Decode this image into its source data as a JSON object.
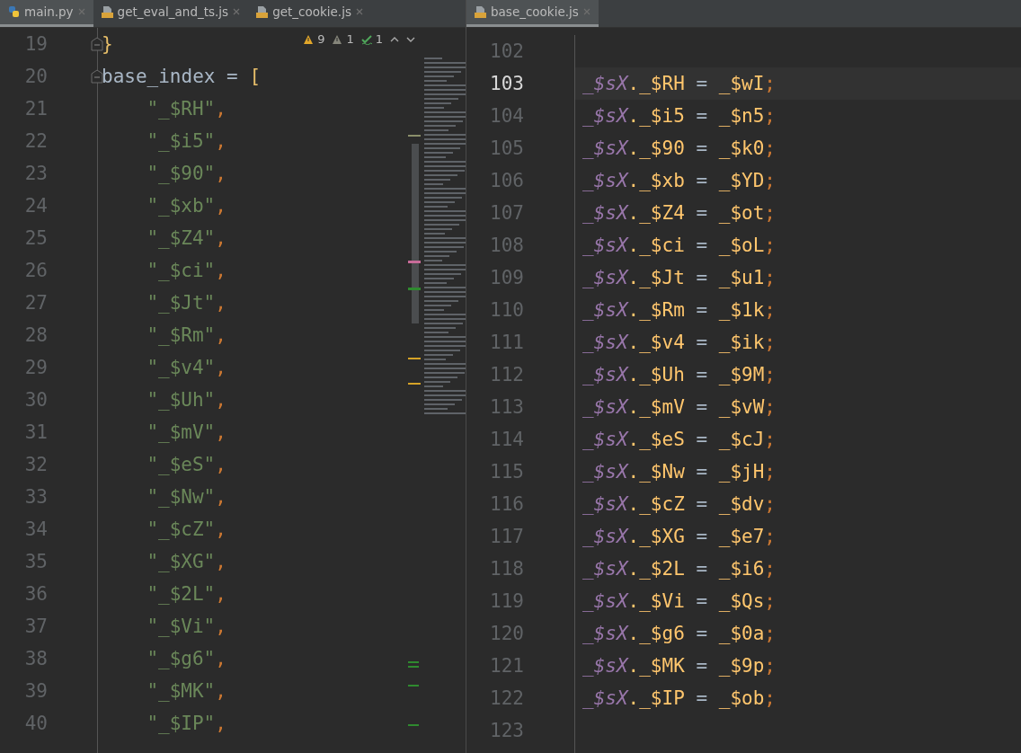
{
  "left_pane": {
    "tabs": [
      {
        "label": "main.py",
        "kind": "python",
        "selected": true
      },
      {
        "label": "get_eval_and_ts.js",
        "kind": "js",
        "selected": false
      },
      {
        "label": "get_cookie.js",
        "kind": "js",
        "selected": false
      }
    ],
    "inspections": [
      {
        "kind": "warning",
        "count": "9"
      },
      {
        "kind": "weak",
        "count": "1"
      },
      {
        "kind": "typo",
        "count": "1"
      }
    ],
    "lines": [
      {
        "number": "19",
        "fold": true,
        "tokens": [
          {
            "kind": "brace",
            "text": "}"
          }
        ]
      },
      {
        "number": "20",
        "fold": true,
        "tokens": [
          {
            "kind": "plain",
            "text": "base_index = "
          },
          {
            "kind": "brace",
            "text": "["
          }
        ]
      },
      {
        "number": "21",
        "indented": true,
        "tokens": [
          {
            "kind": "string",
            "text": "\"_$RH\""
          },
          {
            "kind": "punct",
            "text": ","
          }
        ]
      },
      {
        "number": "22",
        "indented": true,
        "tokens": [
          {
            "kind": "string",
            "text": "\"_$i5\""
          },
          {
            "kind": "punct",
            "text": ","
          }
        ]
      },
      {
        "number": "23",
        "indented": true,
        "tokens": [
          {
            "kind": "string",
            "text": "\"_$90\""
          },
          {
            "kind": "punct",
            "text": ","
          }
        ]
      },
      {
        "number": "24",
        "indented": true,
        "tokens": [
          {
            "kind": "string",
            "text": "\"_$xb\""
          },
          {
            "kind": "punct",
            "text": ","
          }
        ]
      },
      {
        "number": "25",
        "indented": true,
        "tokens": [
          {
            "kind": "string",
            "text": "\"_$Z4\""
          },
          {
            "kind": "punct",
            "text": ","
          }
        ]
      },
      {
        "number": "26",
        "indented": true,
        "tokens": [
          {
            "kind": "string",
            "text": "\"_$ci\""
          },
          {
            "kind": "punct",
            "text": ","
          }
        ]
      },
      {
        "number": "27",
        "indented": true,
        "tokens": [
          {
            "kind": "string",
            "text": "\"_$Jt\""
          },
          {
            "kind": "punct",
            "text": ","
          }
        ]
      },
      {
        "number": "28",
        "indented": true,
        "tokens": [
          {
            "kind": "string",
            "text": "\"_$Rm\""
          },
          {
            "kind": "punct",
            "text": ","
          }
        ]
      },
      {
        "number": "29",
        "indented": true,
        "tokens": [
          {
            "kind": "string",
            "text": "\"_$v4\""
          },
          {
            "kind": "punct",
            "text": ","
          }
        ]
      },
      {
        "number": "30",
        "indented": true,
        "tokens": [
          {
            "kind": "string",
            "text": "\"_$Uh\""
          },
          {
            "kind": "punct",
            "text": ","
          }
        ]
      },
      {
        "number": "31",
        "indented": true,
        "tokens": [
          {
            "kind": "string",
            "text": "\"_$mV\""
          },
          {
            "kind": "punct",
            "text": ","
          }
        ]
      },
      {
        "number": "32",
        "indented": true,
        "tokens": [
          {
            "kind": "string",
            "text": "\"_$eS\""
          },
          {
            "kind": "punct",
            "text": ","
          }
        ]
      },
      {
        "number": "33",
        "indented": true,
        "tokens": [
          {
            "kind": "string",
            "text": "\"_$Nw\""
          },
          {
            "kind": "punct",
            "text": ","
          }
        ]
      },
      {
        "number": "34",
        "indented": true,
        "tokens": [
          {
            "kind": "string",
            "text": "\"_$cZ\""
          },
          {
            "kind": "punct",
            "text": ","
          }
        ]
      },
      {
        "number": "35",
        "indented": true,
        "tokens": [
          {
            "kind": "string",
            "text": "\"_$XG\""
          },
          {
            "kind": "punct",
            "text": ","
          }
        ]
      },
      {
        "number": "36",
        "indented": true,
        "tokens": [
          {
            "kind": "string",
            "text": "\"_$2L\""
          },
          {
            "kind": "punct",
            "text": ","
          }
        ]
      },
      {
        "number": "37",
        "indented": true,
        "tokens": [
          {
            "kind": "string",
            "text": "\"_$Vi\""
          },
          {
            "kind": "punct",
            "text": ","
          }
        ]
      },
      {
        "number": "38",
        "indented": true,
        "tokens": [
          {
            "kind": "string",
            "text": "\"_$g6\""
          },
          {
            "kind": "punct",
            "text": ","
          }
        ]
      },
      {
        "number": "39",
        "indented": true,
        "tokens": [
          {
            "kind": "string",
            "text": "\"_$MK\""
          },
          {
            "kind": "punct",
            "text": ","
          }
        ]
      },
      {
        "number": "40",
        "indented": true,
        "tokens": [
          {
            "kind": "string",
            "text": "\"_$IP\""
          },
          {
            "kind": "punct",
            "text": ","
          }
        ]
      }
    ]
  },
  "right_pane": {
    "tabs": [
      {
        "label": "base_cookie.js",
        "kind": "js",
        "selected": true
      }
    ],
    "lines": [
      {
        "number": "102",
        "current": false
      },
      {
        "number": "103",
        "current": true,
        "tokens": [
          {
            "kind": "object",
            "text": "_$sX"
          },
          {
            "kind": "prop",
            "text": "._$RH"
          },
          {
            "kind": "plain",
            "text": " = "
          },
          {
            "kind": "prop",
            "text": "_$wI"
          },
          {
            "kind": "punct",
            "text": ";"
          }
        ]
      },
      {
        "number": "104",
        "current": false,
        "tokens": [
          {
            "kind": "object",
            "text": "_$sX"
          },
          {
            "kind": "prop",
            "text": "._$i5"
          },
          {
            "kind": "plain",
            "text": " = "
          },
          {
            "kind": "prop",
            "text": "_$n5"
          },
          {
            "kind": "punct",
            "text": ";"
          }
        ]
      },
      {
        "number": "105",
        "current": false,
        "tokens": [
          {
            "kind": "object",
            "text": "_$sX"
          },
          {
            "kind": "prop",
            "text": "._$90"
          },
          {
            "kind": "plain",
            "text": " = "
          },
          {
            "kind": "prop",
            "text": "_$k0"
          },
          {
            "kind": "punct",
            "text": ";"
          }
        ]
      },
      {
        "number": "106",
        "current": false,
        "tokens": [
          {
            "kind": "object",
            "text": "_$sX"
          },
          {
            "kind": "prop",
            "text": "._$xb"
          },
          {
            "kind": "plain",
            "text": " = "
          },
          {
            "kind": "prop",
            "text": "_$YD"
          },
          {
            "kind": "punct",
            "text": ";"
          }
        ]
      },
      {
        "number": "107",
        "current": false,
        "tokens": [
          {
            "kind": "object",
            "text": "_$sX"
          },
          {
            "kind": "prop",
            "text": "._$Z4"
          },
          {
            "kind": "plain",
            "text": " = "
          },
          {
            "kind": "prop",
            "text": "_$ot"
          },
          {
            "kind": "punct",
            "text": ";"
          }
        ]
      },
      {
        "number": "108",
        "current": false,
        "tokens": [
          {
            "kind": "object",
            "text": "_$sX"
          },
          {
            "kind": "prop",
            "text": "._$ci"
          },
          {
            "kind": "plain",
            "text": " = "
          },
          {
            "kind": "prop",
            "text": "_$oL"
          },
          {
            "kind": "punct",
            "text": ";"
          }
        ]
      },
      {
        "number": "109",
        "current": false,
        "tokens": [
          {
            "kind": "object",
            "text": "_$sX"
          },
          {
            "kind": "prop",
            "text": "._$Jt"
          },
          {
            "kind": "plain",
            "text": " = "
          },
          {
            "kind": "prop",
            "text": "_$u1"
          },
          {
            "kind": "punct",
            "text": ";"
          }
        ]
      },
      {
        "number": "110",
        "current": false,
        "tokens": [
          {
            "kind": "object",
            "text": "_$sX"
          },
          {
            "kind": "prop",
            "text": "._$Rm"
          },
          {
            "kind": "plain",
            "text": " = "
          },
          {
            "kind": "prop",
            "text": "_$1k"
          },
          {
            "kind": "punct",
            "text": ";"
          }
        ]
      },
      {
        "number": "111",
        "current": false,
        "tokens": [
          {
            "kind": "object",
            "text": "_$sX"
          },
          {
            "kind": "prop",
            "text": "._$v4"
          },
          {
            "kind": "plain",
            "text": " = "
          },
          {
            "kind": "prop",
            "text": "_$ik"
          },
          {
            "kind": "punct",
            "text": ";"
          }
        ]
      },
      {
        "number": "112",
        "current": false,
        "tokens": [
          {
            "kind": "object",
            "text": "_$sX"
          },
          {
            "kind": "prop",
            "text": "._$Uh"
          },
          {
            "kind": "plain",
            "text": " = "
          },
          {
            "kind": "prop",
            "text": "_$9M"
          },
          {
            "kind": "punct",
            "text": ";"
          }
        ]
      },
      {
        "number": "113",
        "current": false,
        "tokens": [
          {
            "kind": "object",
            "text": "_$sX"
          },
          {
            "kind": "prop",
            "text": "._$mV"
          },
          {
            "kind": "plain",
            "text": " = "
          },
          {
            "kind": "prop",
            "text": "_$vW"
          },
          {
            "kind": "punct",
            "text": ";"
          }
        ]
      },
      {
        "number": "114",
        "current": false,
        "tokens": [
          {
            "kind": "object",
            "text": "_$sX"
          },
          {
            "kind": "prop",
            "text": "._$eS"
          },
          {
            "kind": "plain",
            "text": " = "
          },
          {
            "kind": "prop",
            "text": "_$cJ"
          },
          {
            "kind": "punct",
            "text": ";"
          }
        ]
      },
      {
        "number": "115",
        "current": false,
        "tokens": [
          {
            "kind": "object",
            "text": "_$sX"
          },
          {
            "kind": "prop",
            "text": "._$Nw"
          },
          {
            "kind": "plain",
            "text": " = "
          },
          {
            "kind": "prop",
            "text": "_$jH"
          },
          {
            "kind": "punct",
            "text": ";"
          }
        ]
      },
      {
        "number": "116",
        "current": false,
        "tokens": [
          {
            "kind": "object",
            "text": "_$sX"
          },
          {
            "kind": "prop",
            "text": "._$cZ"
          },
          {
            "kind": "plain",
            "text": " = "
          },
          {
            "kind": "prop",
            "text": "_$dv"
          },
          {
            "kind": "punct",
            "text": ";"
          }
        ]
      },
      {
        "number": "117",
        "current": false,
        "tokens": [
          {
            "kind": "object",
            "text": "_$sX"
          },
          {
            "kind": "prop",
            "text": "._$XG"
          },
          {
            "kind": "plain",
            "text": " = "
          },
          {
            "kind": "prop",
            "text": "_$e7"
          },
          {
            "kind": "punct",
            "text": ";"
          }
        ]
      },
      {
        "number": "118",
        "current": false,
        "tokens": [
          {
            "kind": "object",
            "text": "_$sX"
          },
          {
            "kind": "prop",
            "text": "._$2L"
          },
          {
            "kind": "plain",
            "text": " = "
          },
          {
            "kind": "prop",
            "text": "_$i6"
          },
          {
            "kind": "punct",
            "text": ";"
          }
        ]
      },
      {
        "number": "119",
        "current": false,
        "tokens": [
          {
            "kind": "object",
            "text": "_$sX"
          },
          {
            "kind": "prop",
            "text": "._$Vi"
          },
          {
            "kind": "plain",
            "text": " = "
          },
          {
            "kind": "prop",
            "text": "_$Qs"
          },
          {
            "kind": "punct",
            "text": ";"
          }
        ]
      },
      {
        "number": "120",
        "current": false,
        "tokens": [
          {
            "kind": "object",
            "text": "_$sX"
          },
          {
            "kind": "prop",
            "text": "._$g6"
          },
          {
            "kind": "plain",
            "text": " = "
          },
          {
            "kind": "prop",
            "text": "_$0a"
          },
          {
            "kind": "punct",
            "text": ";"
          }
        ]
      },
      {
        "number": "121",
        "current": false,
        "tokens": [
          {
            "kind": "object",
            "text": "_$sX"
          },
          {
            "kind": "prop",
            "text": "._$MK"
          },
          {
            "kind": "plain",
            "text": " = "
          },
          {
            "kind": "prop",
            "text": "_$9p"
          },
          {
            "kind": "punct",
            "text": ";"
          }
        ]
      },
      {
        "number": "122",
        "current": false,
        "tokens": [
          {
            "kind": "object",
            "text": "_$sX"
          },
          {
            "kind": "prop",
            "text": "._$IP"
          },
          {
            "kind": "plain",
            "text": " = "
          },
          {
            "kind": "prop",
            "text": "_$ob"
          },
          {
            "kind": "punct",
            "text": ";"
          }
        ]
      },
      {
        "number": "123",
        "current": false
      }
    ]
  }
}
